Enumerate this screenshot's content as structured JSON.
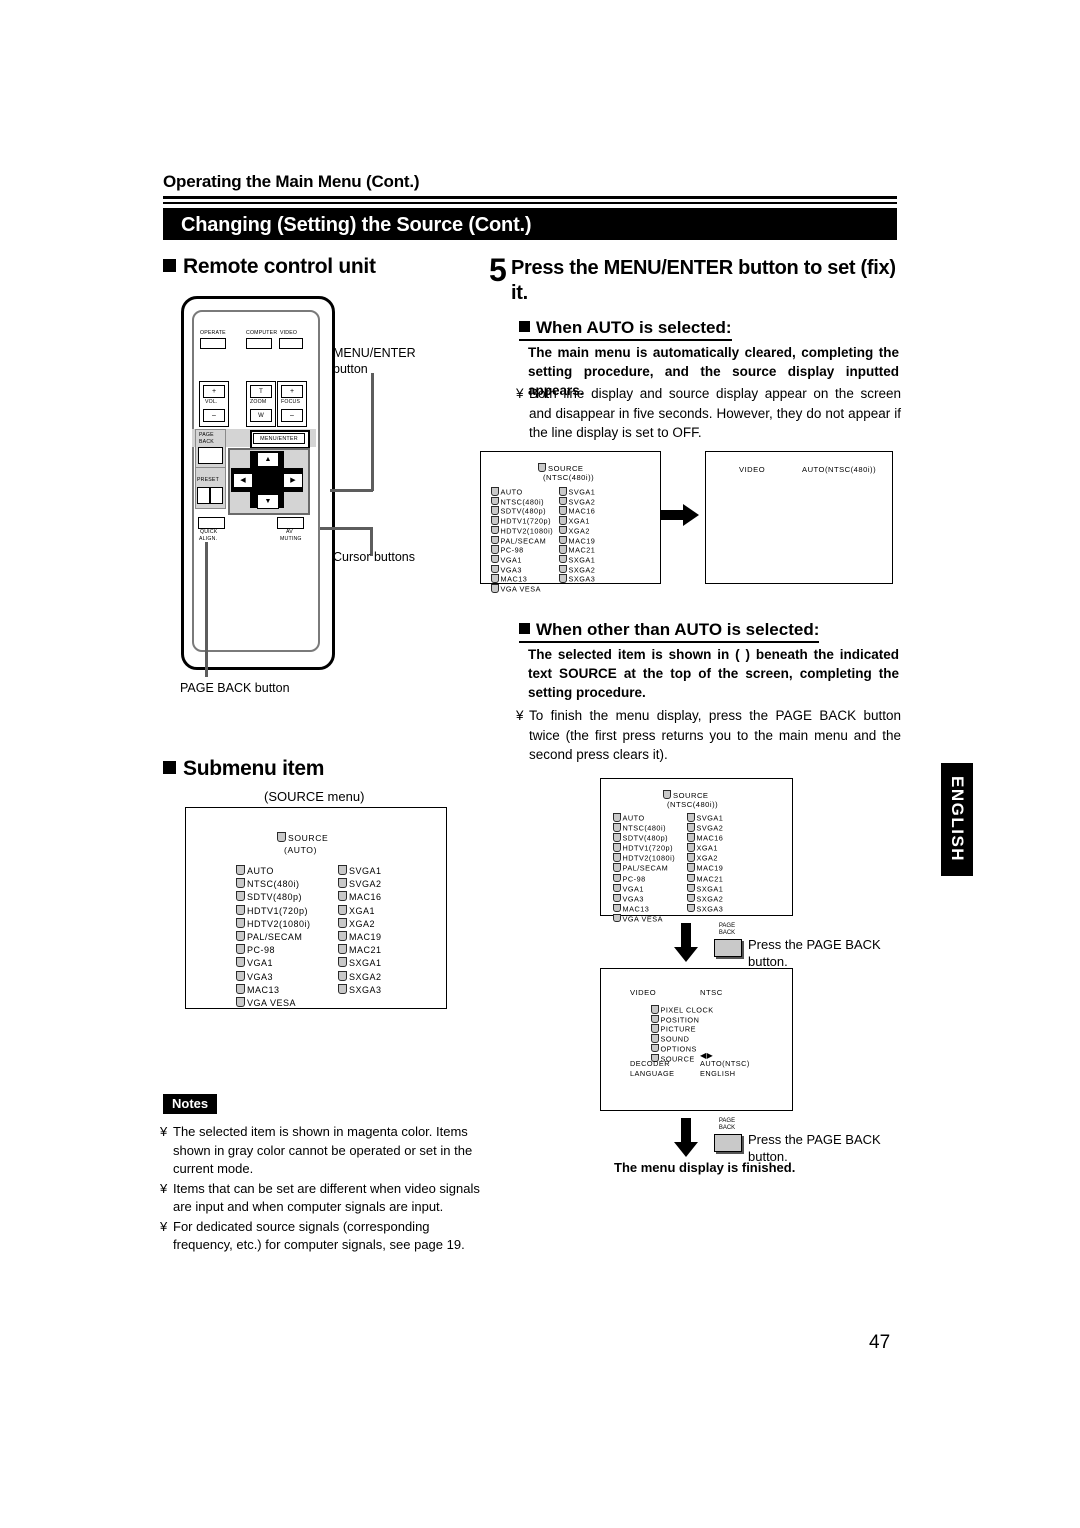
{
  "header": {
    "running_head": "Operating the Main Menu (Cont.)",
    "title": "Changing (Setting) the Source (Cont.)"
  },
  "left_column": {
    "remote_heading": "Remote control unit",
    "remote": {
      "buttons": [
        "OPERATE",
        "COMPUTER",
        "VIDEO",
        "VOL.",
        "ZOOM",
        "FOCUS",
        "MENU/ENTER",
        "PAGE BACK",
        "PRESET",
        "QUICK ALIGN.",
        "AV MUTING"
      ],
      "vol_plus": "+",
      "vol_minus": "–",
      "zoom_t": "T",
      "zoom_w": "W",
      "focus_plus": "+",
      "focus_minus": "–",
      "operate_label": "OPERATE",
      "computer_label": "COMPUTER",
      "video_label": "VIDEO",
      "vol_label": "VOL.",
      "zoom_label": "ZOOM",
      "focus_label": "FOCUS",
      "menuenter_label": "MENU/ENTER",
      "page_label": "PAGE",
      "back_label": "BACK",
      "preset_label": "PRESET",
      "quick_label": "QUICK",
      "align_label": "ALIGN.",
      "av_label": "AV",
      "muting_label": "MUTING",
      "arrow_up": "▲",
      "arrow_down": "▼",
      "arrow_left": "◀",
      "arrow_right": "▶"
    },
    "callouts": {
      "menu_enter": "MENU/ENTER\nbutton",
      "menu_enter_l1": "MENU/ENTER",
      "menu_enter_l2": "button",
      "cursor_buttons": "Cursor buttons",
      "page_back_button": "PAGE BACK button"
    },
    "submenu_heading": "Submenu item",
    "source_menu_caption": "(SOURCE menu)",
    "source_menu": {
      "title": "SOURCE",
      "subtitle": "(AUTO)",
      "col1": [
        "AUTO",
        "NTSC(480i)",
        "SDTV(480p)",
        "HDTV1(720p)",
        "HDTV2(1080i)",
        "PAL/SECAM",
        "PC-98",
        "VGA1",
        "VGA3",
        "MAC13",
        "VGA VESA"
      ],
      "col2": [
        "SVGA1",
        "SVGA2",
        "MAC16",
        "XGA1",
        "XGA2",
        "MAC19",
        "MAC21",
        "SXGA1",
        "SXGA2",
        "SXGA3"
      ]
    },
    "notes": {
      "label": "Notes",
      "items": [
        "The selected item is shown in magenta color. Items shown in gray color cannot be operated or set in the current mode.",
        "Items that can be set are different when video signals are input and when computer signals are input.",
        "For dedicated source signals (corresponding frequency, etc.) for computer signals, see page 19."
      ],
      "bullet": "¥"
    }
  },
  "right_column": {
    "step_number": "5",
    "step_text": "Press the MENU/ENTER button to set (fix) it.",
    "auto_section": {
      "heading": "When AUTO is selected:",
      "bold_text": "The main menu is automatically cleared, completing the setting procedure, and the source display inputted appears.",
      "note": "Both line display and source display appear on the screen and disappear in five seconds. However, they do not appear if the line display is set to OFF.",
      "bullet": "¥"
    },
    "auto_screen_left": {
      "title": "SOURCE",
      "subtitle": "(NTSC(480i))",
      "col1": [
        "AUTO",
        "NTSC(480i)",
        "SDTV(480p)",
        "HDTV1(720p)",
        "HDTV2(1080i)",
        "PAL/SECAM",
        "PC-98",
        "VGA1",
        "VGA3",
        "MAC13",
        "VGA VESA"
      ],
      "col2": [
        "SVGA1",
        "SVGA2",
        "MAC16",
        "XGA1",
        "XGA2",
        "MAC19",
        "MAC21",
        "SXGA1",
        "SXGA2",
        "SXGA3"
      ]
    },
    "auto_screen_right": {
      "left_text": "VIDEO",
      "right_text": "AUTO(NTSC(480i))"
    },
    "other_section": {
      "heading": "When other than AUTO is selected:",
      "bold_text": "The selected item is shown in (    ) beneath the indicated text  SOURCE  at the top of the screen, completing the setting procedure.",
      "note": "To finish the menu display, press the PAGE BACK button twice (the first press returns you to the main menu and the second press clears it).",
      "bullet": "¥"
    },
    "source_screen": {
      "title": "SOURCE",
      "subtitle": "(NTSC(480i))",
      "col1": [
        "AUTO",
        "NTSC(480i)",
        "SDTV(480p)",
        "HDTV1(720p)",
        "HDTV2(1080i)",
        "PAL/SECAM",
        "PC-98",
        "VGA1",
        "VGA3",
        "MAC13",
        "VGA VESA"
      ],
      "col2": [
        "SVGA1",
        "SVGA2",
        "MAC16",
        "XGA1",
        "XGA2",
        "MAC19",
        "MAC21",
        "SXGA1",
        "SXGA2",
        "SXGA3"
      ]
    },
    "press_pageback_1": {
      "btn_l1": "PAGE",
      "btn_l2": "BACK",
      "caption_l1": "Press the PAGE BACK",
      "caption_l2": "button."
    },
    "main_menu_screen": {
      "left_text": "VIDEO",
      "right_text": "NTSC",
      "items": [
        "PIXEL CLOCK",
        "POSITION",
        "PICTURE",
        "SOUND",
        "OPTIONS",
        "SOURCE"
      ],
      "adjust_marks": "◀▶",
      "rows": [
        {
          "label": "DECODER",
          "value": "AUTO(NTSC)"
        },
        {
          "label": "LANGUAGE",
          "value": "ENGLISH"
        }
      ]
    },
    "press_pageback_2": {
      "btn_l1": "PAGE",
      "btn_l2": "BACK",
      "caption_l1": "Press the PAGE BACK",
      "caption_l2": "button."
    },
    "finished_text": "The menu display is finished."
  },
  "sidebar": {
    "language_tab": "ENGLISH"
  },
  "footer": {
    "page_number": "47"
  },
  "colors": {
    "accent": "#000000",
    "panel_gray": "#d4d4d4",
    "icon_gray": "#c9c9c9"
  }
}
